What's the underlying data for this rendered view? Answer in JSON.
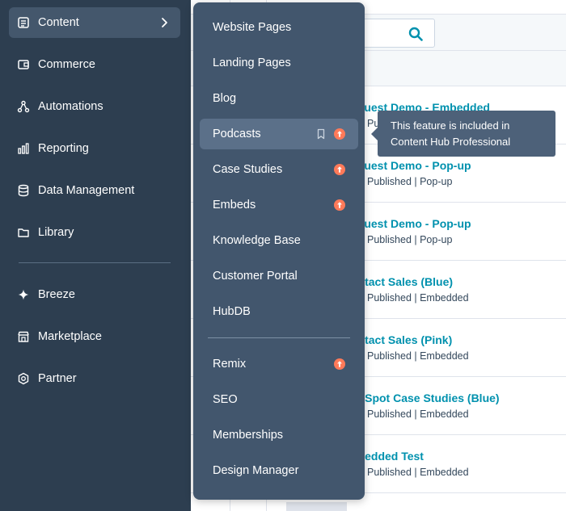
{
  "sidebar": {
    "items": [
      {
        "label": "Content",
        "icon": "content-icon"
      },
      {
        "label": "Commerce",
        "icon": "commerce-icon"
      },
      {
        "label": "Automations",
        "icon": "automations-icon"
      },
      {
        "label": "Reporting",
        "icon": "reporting-icon"
      },
      {
        "label": "Data Management",
        "icon": "data-management-icon"
      },
      {
        "label": "Library",
        "icon": "folder-icon"
      },
      {
        "label": "Breeze",
        "icon": "sparkle-icon"
      },
      {
        "label": "Marketplace",
        "icon": "store-icon"
      },
      {
        "label": "Partner",
        "icon": "partner-badge-icon"
      }
    ]
  },
  "flyout": {
    "items": [
      {
        "label": "Website Pages"
      },
      {
        "label": "Landing Pages"
      },
      {
        "label": "Blog"
      },
      {
        "label": "Podcasts",
        "upgrade": true,
        "bookmark": true
      },
      {
        "label": "Case Studies",
        "upgrade": true
      },
      {
        "label": "Embeds",
        "upgrade": true
      },
      {
        "label": "Knowledge Base"
      },
      {
        "label": "Customer Portal"
      },
      {
        "label": "HubDB"
      },
      {
        "label": "Remix",
        "upgrade": true
      },
      {
        "label": "SEO"
      },
      {
        "label": "Memberships"
      },
      {
        "label": "Design Manager"
      }
    ]
  },
  "tooltip": {
    "line1": "This feature is included in",
    "line2": "Content Hub Professional"
  },
  "table": {
    "rows": [
      {
        "title": "equest Demo - Embedded",
        "subtitle": "Pu"
      },
      {
        "title": "equest Demo - Pop-up",
        "subtitle": "Published | Pop-up"
      },
      {
        "title": "equest Demo - Pop-up",
        "subtitle": "Published | Pop-up"
      },
      {
        "title": "ontact Sales (Blue)",
        "subtitle": "Published | Embedded"
      },
      {
        "title": "ontact Sales (Pink)",
        "subtitle": "Published | Embedded"
      },
      {
        "title": "ubSpot Case Studies (Blue)",
        "subtitle": "Published | Embedded"
      },
      {
        "title": "nbedded Test",
        "subtitle": "Published | Embedded"
      }
    ]
  },
  "colors": {
    "sidebar_bg": "#2d3e50",
    "flyout_bg": "#42566d",
    "link": "#0091ae",
    "upgrade_badge": "#ff7a59"
  }
}
